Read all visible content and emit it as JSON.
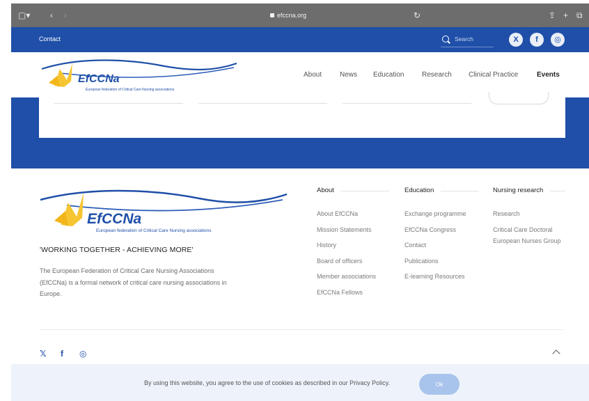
{
  "browser": {
    "url": "efccna.org"
  },
  "topbar": {
    "contact_label": "Contact",
    "search_placeholder": "Search",
    "social": [
      "X",
      "f",
      "◎"
    ]
  },
  "header": {
    "logo": {
      "brand": "EfCCNa",
      "subtitle": "European federation of Critical Care Nursing associations"
    },
    "nav": [
      "About",
      "News",
      "Education",
      "Research",
      "Clinical Practice",
      "Events"
    ]
  },
  "footer": {
    "logo": {
      "brand": "EfCCNa",
      "subtitle": "European federation of Critical Care Nursing associations"
    },
    "tagline": "'WORKING TOGETHER - ACHIEVING MORE'",
    "description": "The European Federation of Critical Care Nursing Associations (EfCCNa) is a formal network of critical care nursing associations in Europe.",
    "columns": [
      {
        "title": "About",
        "links": [
          "About EfCCNa",
          "Mission Statements",
          "History",
          "Board of officers",
          "Member associations",
          "EfCCNa Fellows"
        ]
      },
      {
        "title": "Education",
        "links": [
          "Exchange programme",
          "EfCCNa Congress",
          "Contact",
          "Publications",
          "E-learning Resources"
        ]
      },
      {
        "title": "Nursing research",
        "links": [
          "Research",
          "Critical Care Doctoral European Nurses Group"
        ]
      }
    ],
    "social": [
      "𝕏",
      "f",
      "◎"
    ]
  },
  "cookie": {
    "text": "By using this website, you agree to the use of cookies as described in our Privacy Policy.",
    "ok_label": "Ok"
  },
  "colors": {
    "brand_blue": "#1f4fa8",
    "logo_yellow": "#f6c531",
    "cookie_bg": "#eef3fb",
    "ok_button": "#a9c4ec"
  }
}
